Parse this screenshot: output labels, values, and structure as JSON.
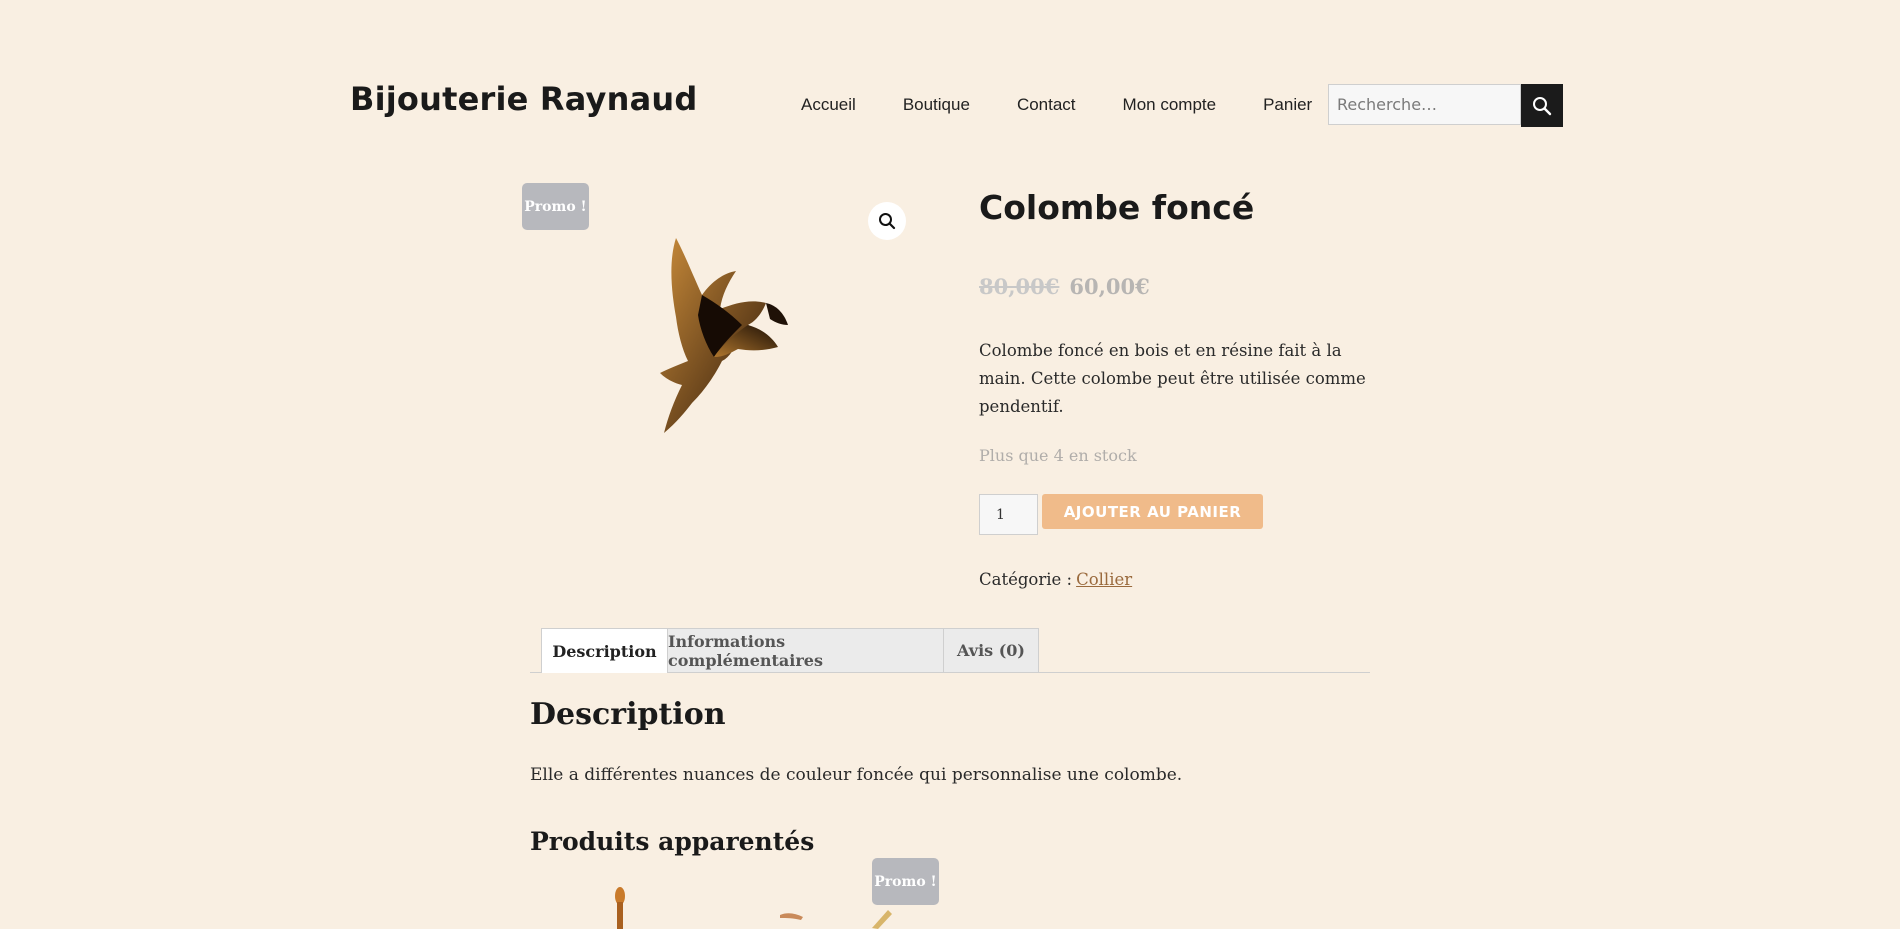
{
  "site": {
    "title": "Bijouterie Raynaud"
  },
  "nav": {
    "items": [
      "Accueil",
      "Boutique",
      "Contact",
      "Mon compte",
      "Panier"
    ]
  },
  "search": {
    "placeholder": "Recherche…"
  },
  "product": {
    "badge": "Promo !",
    "title": "Colombe foncé",
    "price_old": "80,00€",
    "price_new": "60,00€",
    "short_description": "Colombe foncé en bois et en résine fait à la main. Cette colombe peut être utilisée comme pendentif.",
    "stock": "Plus que 4 en stock",
    "quantity": "1",
    "add_to_cart": "AJOUTER AU PANIER",
    "category_label": "Catégorie :",
    "category": "Collier"
  },
  "tabs": [
    "Description",
    "Informations complémentaires",
    "Avis (0)"
  ],
  "description": {
    "heading": "Description",
    "text": "Elle a différentes nuances de couleur foncée qui personnalise une colombe."
  },
  "related": {
    "heading": "Produits apparentés",
    "badge": "Promo !"
  },
  "colors": {
    "background": "#f9efe2",
    "accent": "#f0bb8a",
    "badge": "#b7b8bd",
    "link": "#9a6a3d"
  }
}
